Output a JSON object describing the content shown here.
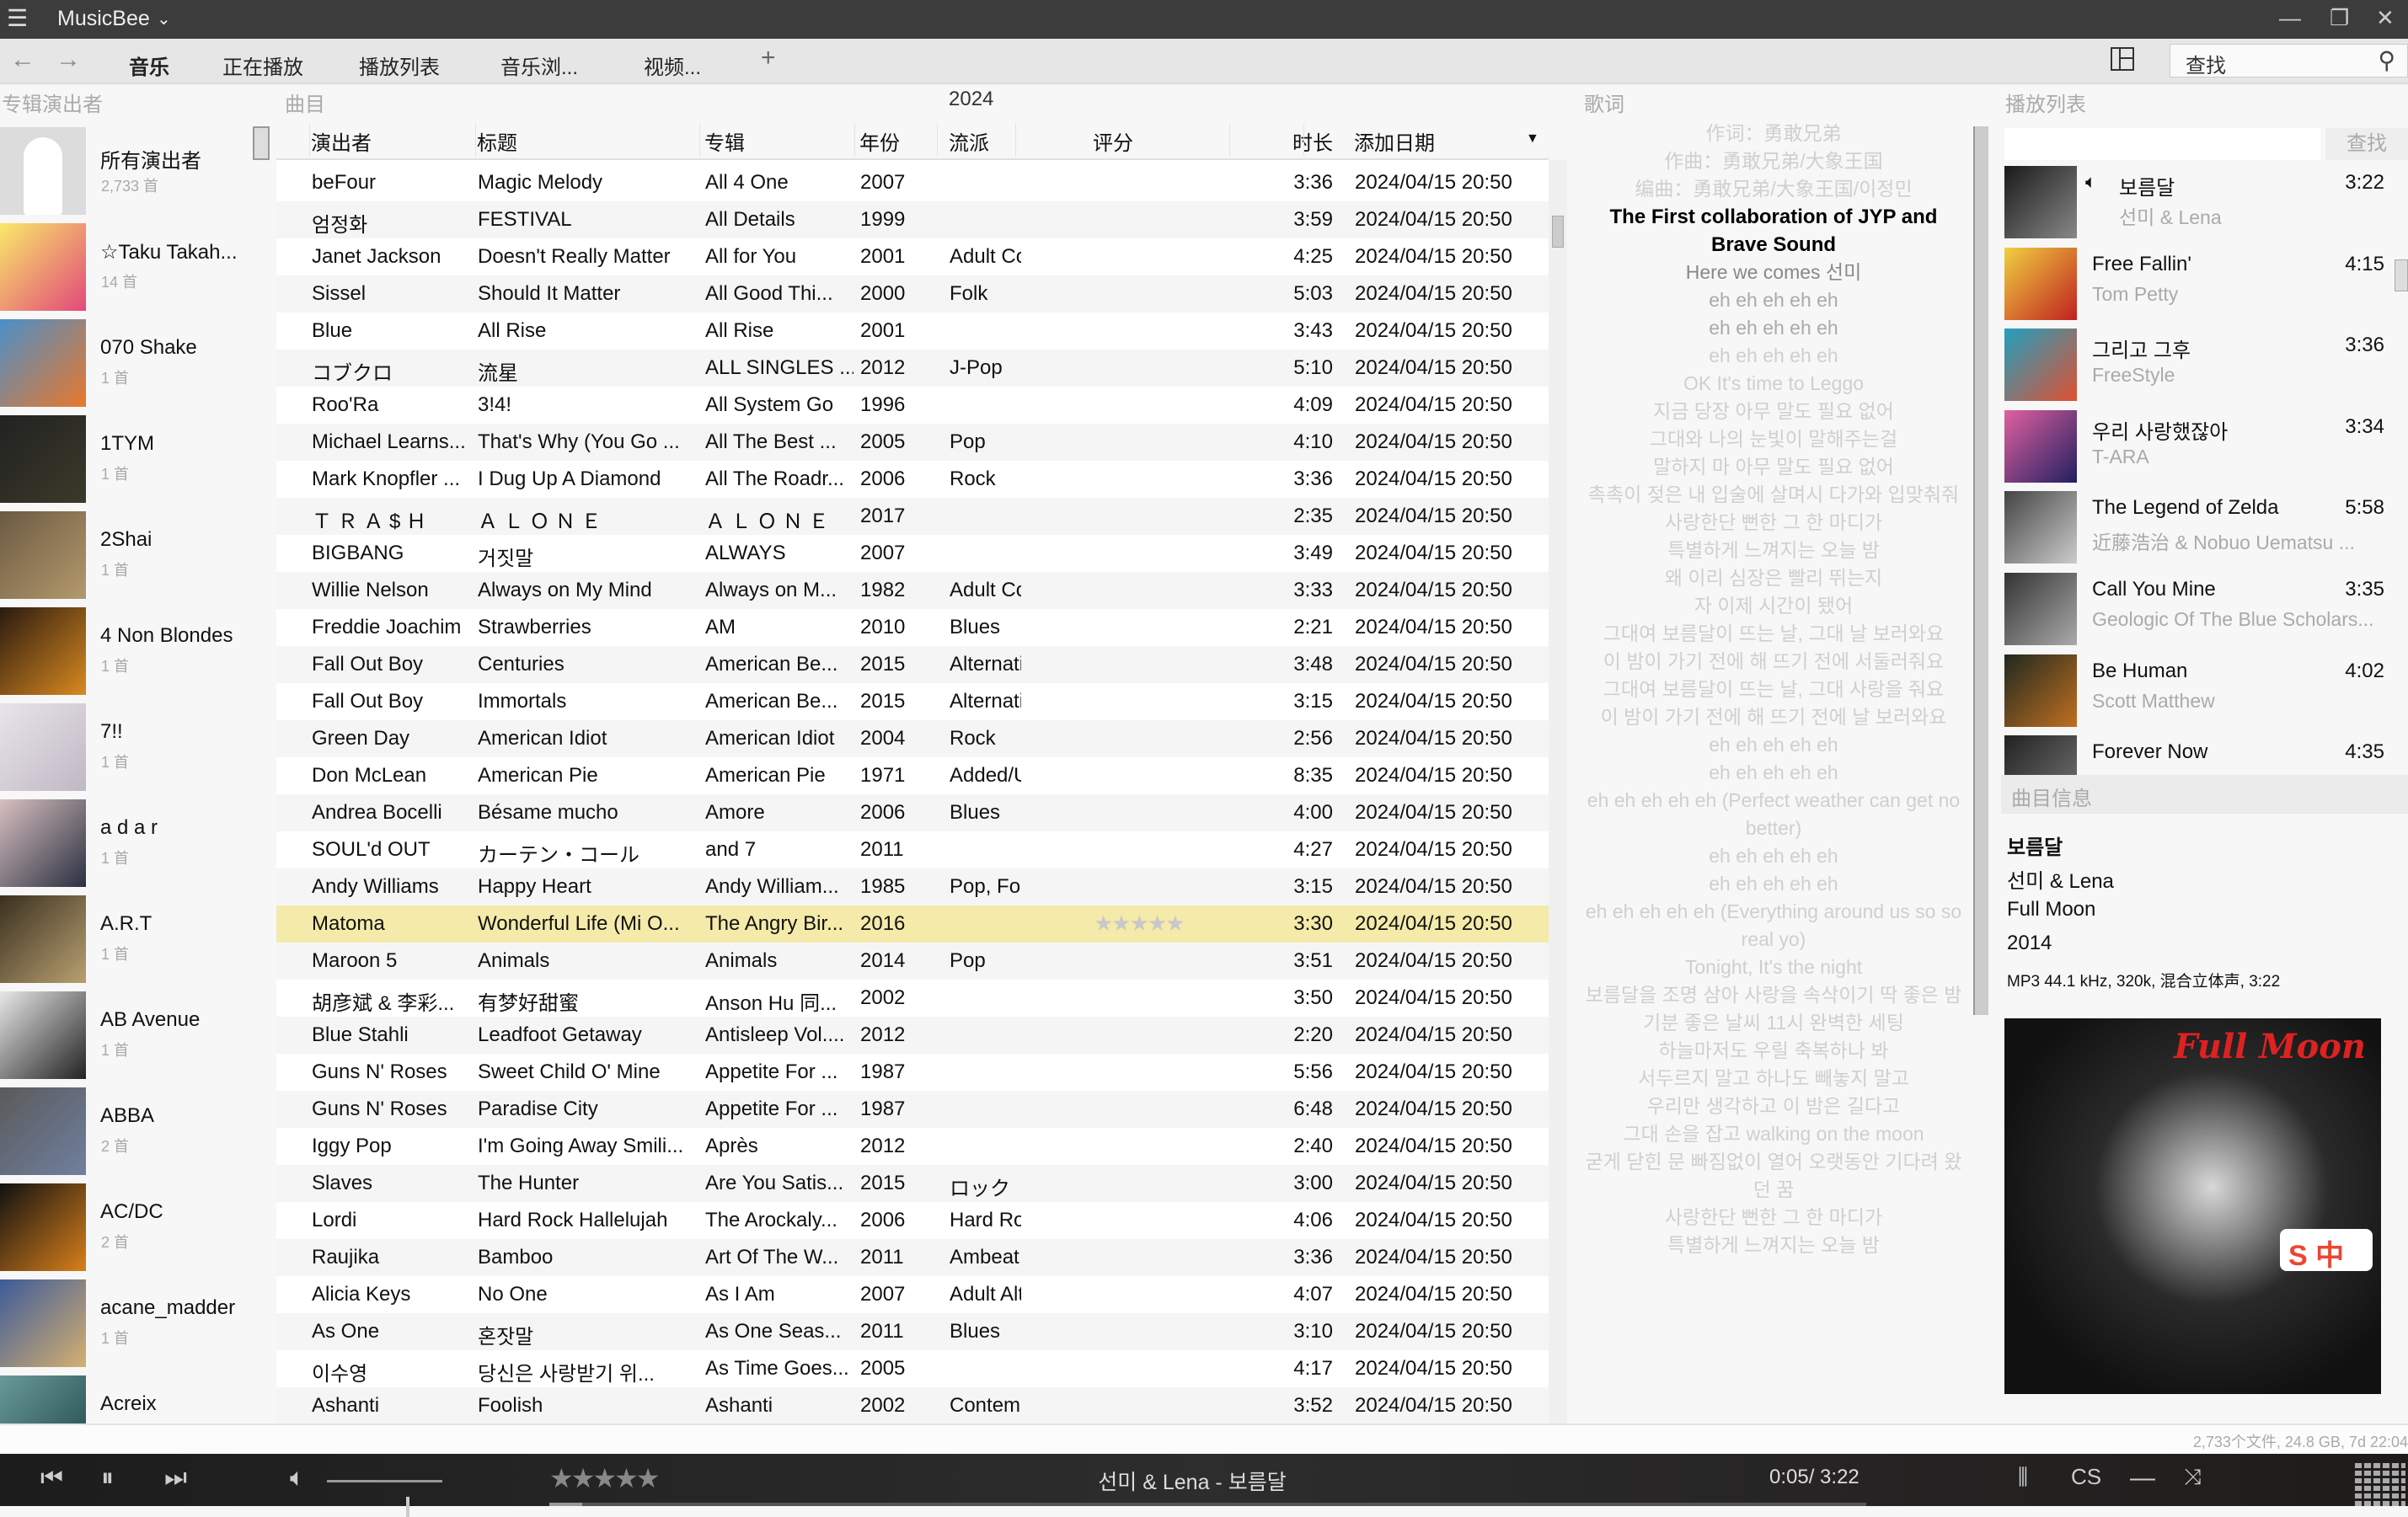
{
  "titlebar": {
    "app_name": "MusicBee"
  },
  "nav": {
    "tabs": [
      "音乐",
      "正在播放",
      "播放列表",
      "音乐浏...",
      "视频..."
    ],
    "active_tab": 0,
    "search_placeholder": "查找"
  },
  "panels": {
    "artists_header": "专辑演出者",
    "tracks_header": "曲目",
    "filter_year": "2024",
    "lyrics_header": "歌词",
    "playlist_header": "播放列表"
  },
  "sidebar": {
    "items": [
      {
        "name": "所有演出者",
        "count": "2,733 首",
        "art": [
          "#dcdcdc",
          "#dcdcdc"
        ]
      },
      {
        "name": "☆Taku Takah...",
        "count": "14 首",
        "art": [
          "#f9e96a",
          "#e2487a"
        ]
      },
      {
        "name": "070 Shake",
        "count": "1 首",
        "art": [
          "#4a90c8",
          "#e8782c"
        ]
      },
      {
        "name": "1TYM",
        "count": "1 首",
        "art": [
          "#222",
          "#3a3a2a"
        ]
      },
      {
        "name": "2Shai",
        "count": "1 首",
        "art": [
          "#6b5a42",
          "#b4996c"
        ]
      },
      {
        "name": "4 Non Blondes",
        "count": "1 首",
        "art": [
          "#2a1a10",
          "#d98a20"
        ]
      },
      {
        "name": "7!!",
        "count": "1 首",
        "art": [
          "#e8e4ea",
          "#c0b8c4"
        ]
      },
      {
        "name": "a d a r",
        "count": "1 首",
        "art": [
          "#d8c0c0",
          "#2a3040"
        ]
      },
      {
        "name": "A.R.T",
        "count": "1 首",
        "art": [
          "#3a3020",
          "#b8a070"
        ]
      },
      {
        "name": "AB Avenue",
        "count": "1 首",
        "art": [
          "#e8e8e8",
          "#222"
        ]
      },
      {
        "name": "ABBA",
        "count": "2 首",
        "art": [
          "#5a5a5a",
          "#7080a0"
        ]
      },
      {
        "name": "AC/DC",
        "count": "2 首",
        "art": [
          "#111",
          "#d8801a"
        ]
      },
      {
        "name": "acane_madder",
        "count": "1 首",
        "art": [
          "#3c5a9a",
          "#d4b070"
        ]
      },
      {
        "name": "Acreix",
        "count": "",
        "art": [
          "#6a9a9a",
          "#204848"
        ]
      }
    ]
  },
  "table": {
    "columns": [
      "演出者",
      "标题",
      "专辑",
      "年份",
      "流派",
      "评分",
      "时长",
      "添加日期"
    ],
    "sort_column": "添加日期",
    "sort_direction": "descending",
    "selected_row": 20,
    "rows": [
      [
        "beFour",
        "Magic Melody",
        "All 4 One",
        "2007",
        "",
        "",
        "3:36",
        "2024/04/15 20:50"
      ],
      [
        "엄정화",
        "FESTIVAL",
        "All Details",
        "1999",
        "",
        "",
        "3:59",
        "2024/04/15 20:50"
      ],
      [
        "Janet Jackson",
        "Doesn't Really Matter",
        "All for You",
        "2001",
        "Adult Conte...",
        "",
        "4:25",
        "2024/04/15 20:50"
      ],
      [
        "Sissel",
        "Should It Matter",
        "All Good Thi...",
        "2000",
        "Folk",
        "",
        "5:03",
        "2024/04/15 20:50"
      ],
      [
        "Blue",
        "All Rise",
        "All Rise",
        "2001",
        "",
        "",
        "3:43",
        "2024/04/15 20:50"
      ],
      [
        "コブクロ",
        "流星",
        "ALL SINGLES ...",
        "2012",
        "J-Pop",
        "",
        "5:10",
        "2024/04/15 20:50"
      ],
      [
        "Roo'Ra",
        "3!4!",
        "All System Go",
        "1996",
        "",
        "",
        "4:09",
        "2024/04/15 20:50"
      ],
      [
        "Michael Learns...",
        "That's Why (You Go ...",
        "All The Best ...",
        "2005",
        "Pop",
        "",
        "4:10",
        "2024/04/15 20:50"
      ],
      [
        "Mark Knopfler ...",
        "I Dug Up A Diamond",
        "All The Roadr...",
        "2006",
        "Rock",
        "",
        "3:36",
        "2024/04/15 20:50"
      ],
      [
        "Ｔ Ｒ Ａ $ Ｈ",
        "Ａ Ｌ Ｏ Ｎ Ｅ",
        "Ａ Ｌ Ｏ Ｎ Ｅ",
        "2017",
        "",
        "",
        "2:35",
        "2024/04/15 20:50"
      ],
      [
        "BIGBANG",
        "거짓말",
        "ALWAYS",
        "2007",
        "",
        "",
        "3:49",
        "2024/04/15 20:50"
      ],
      [
        "Willie Nelson",
        "Always on My Mind",
        "Always on M...",
        "1982",
        "Adult Conte...",
        "",
        "3:33",
        "2024/04/15 20:50"
      ],
      [
        "Freddie Joachim",
        "Strawberries",
        "AM",
        "2010",
        "Blues",
        "",
        "2:21",
        "2024/04/15 20:50"
      ],
      [
        "Fall Out Boy",
        "Centuries",
        "American Be...",
        "2015",
        "Alternative ...",
        "",
        "3:48",
        "2024/04/15 20:50"
      ],
      [
        "Fall Out Boy",
        "Immortals",
        "American Be...",
        "2015",
        "Alternative ...",
        "",
        "3:15",
        "2024/04/15 20:50"
      ],
      [
        "Green Day",
        "American Idiot",
        "American Idiot",
        "2004",
        "Rock",
        "",
        "2:56",
        "2024/04/15 20:50"
      ],
      [
        "Don McLean",
        "American Pie",
        "American Pie",
        "1971",
        "Added/Unk...",
        "",
        "8:35",
        "2024/04/15 20:50"
      ],
      [
        "Andrea Bocelli",
        "Bésame mucho",
        "Amore",
        "2006",
        "Blues",
        "",
        "4:00",
        "2024/04/15 20:50"
      ],
      [
        "SOUL'd OUT",
        "カーテン・コール",
        "and 7",
        "2011",
        "",
        "",
        "4:27",
        "2024/04/15 20:50"
      ],
      [
        "Andy Williams",
        "Happy Heart",
        "Andy William...",
        "1985",
        "Pop, Folk, ...",
        "",
        "3:15",
        "2024/04/15 20:50"
      ],
      [
        "Matoma",
        "Wonderful Life (Mi O...",
        "The Angry Bir...",
        "2016",
        "",
        "★★★★★",
        "3:30",
        "2024/04/15 20:50"
      ],
      [
        "Maroon 5",
        "Animals",
        "Animals",
        "2014",
        "Pop",
        "",
        "3:51",
        "2024/04/15 20:50"
      ],
      [
        "胡彦斌 & 李彩...",
        "有梦好甜蜜",
        "Anson Hu 同...",
        "2002",
        "",
        "",
        "3:50",
        "2024/04/15 20:50"
      ],
      [
        "Blue Stahli",
        "Leadfoot Getaway",
        "Antisleep Vol....",
        "2012",
        "",
        "",
        "2:20",
        "2024/04/15 20:50"
      ],
      [
        "Guns N' Roses",
        "Sweet Child O' Mine",
        "Appetite For ...",
        "1987",
        "",
        "",
        "5:56",
        "2024/04/15 20:50"
      ],
      [
        "Guns N' Roses",
        "Paradise City",
        "Appetite For ...",
        "1987",
        "",
        "",
        "6:48",
        "2024/04/15 20:50"
      ],
      [
        "Iggy Pop",
        "I'm Going Away Smili...",
        "Après",
        "2012",
        "",
        "",
        "2:40",
        "2024/04/15 20:50"
      ],
      [
        "Slaves",
        "The Hunter",
        "Are You Satis...",
        "2015",
        "ロック",
        "",
        "3:00",
        "2024/04/15 20:50"
      ],
      [
        "Lordi",
        "Hard Rock Hallelujah",
        "The Arockaly...",
        "2006",
        "Hard Rock",
        "",
        "4:06",
        "2024/04/15 20:50"
      ],
      [
        "Raujika",
        "Bamboo",
        "Art Of The W...",
        "2011",
        "Ambeat",
        "",
        "3:36",
        "2024/04/15 20:50"
      ],
      [
        "Alicia Keys",
        "No One",
        "As I Am",
        "2007",
        "Adult Altern...",
        "",
        "4:07",
        "2024/04/15 20:50"
      ],
      [
        "As One",
        "혼잣말",
        "As One Seas...",
        "2011",
        "Blues",
        "",
        "3:10",
        "2024/04/15 20:50"
      ],
      [
        "이수영",
        "당신은 사랑받기 위...",
        "As Time Goes...",
        "2005",
        "",
        "",
        "4:17",
        "2024/04/15 20:50"
      ],
      [
        "Ashanti",
        "Foolish",
        "Ashanti",
        "2002",
        "Contempor...",
        "",
        "3:52",
        "2024/04/15 20:50"
      ]
    ]
  },
  "lyrics": {
    "current_line": 3,
    "lines": [
      "作词：勇敢兄弟",
      "作曲：勇敢兄弟/大象王国",
      "编曲：勇敢兄弟/大象王国/이정민",
      "The First collaboration of JYP and Brave Sound",
      "Here we comes 선미",
      "eh eh eh eh eh",
      "eh eh eh eh eh",
      "eh eh eh eh eh",
      "OK It's time to Leggo",
      "지금 당장 아무 말도 필요 없어",
      "그대와 나의 눈빛이 말해주는걸",
      "말하지 마 아무 말도 필요 없어",
      "촉촉이 젖은 내 입술에 살며시 다가와 입맞춰줘",
      "사랑한단 뻔한 그 한 마디가",
      "특별하게 느껴지는 오늘 밤",
      "왜 이리 심장은 빨리 뛰는지",
      "자 이제 시간이 됐어",
      "그대여 보름달이 뜨는 날, 그대 날 보러와요",
      "이 밤이 가기 전에 해 뜨기 전에 서둘러줘요",
      "그대여 보름달이 뜨는 날, 그대 사랑을 줘요",
      "이 밤이 가기 전에 해 뜨기 전에 날 보러와요",
      "eh eh eh eh eh",
      "eh eh eh eh eh",
      "eh eh eh eh eh (Perfect weather can get no better)",
      "eh eh eh eh eh",
      "eh eh eh eh eh",
      "eh eh eh eh eh (Everything around us so so real yo)",
      "Tonight, It's the night",
      "보름달을 조명 삼아 사랑을 속삭이기 딱 좋은 밤",
      "기분 좋은 날씨 11시 완벽한 세팅",
      "하늘마저도 우릴 축복하나 봐",
      "서두르지 말고 하나도 빼놓지 말고",
      "우리만 생각하고 이 밤은 길다고",
      "그대 손을 잡고 walking on the moon",
      "굳게 닫힌 문 빠짐없이 열어 오랫동안 기다려 왔던 꿈",
      "사랑한단 뻔한 그 한 마디가",
      "특별하게 느껴지는 오늘 밤"
    ]
  },
  "playlist": {
    "search_button": "查找",
    "playing_index": 0,
    "items": [
      {
        "title": "보름달",
        "artist": "선미 & Lena",
        "duration": "3:22",
        "art": [
          "#1a1a1a",
          "#888"
        ]
      },
      {
        "title": "Free Fallin'",
        "artist": "Tom Petty",
        "duration": "4:15",
        "art": [
          "#f0d040",
          "#c02020"
        ]
      },
      {
        "title": "그리고 그후",
        "artist": "FreeStyle",
        "duration": "3:36",
        "art": [
          "#20a0c0",
          "#e05030"
        ]
      },
      {
        "title": "우리 사랑했잖아",
        "artist": "T-ARA",
        "duration": "3:34",
        "art": [
          "#e060a0",
          "#202060"
        ]
      },
      {
        "title": "The Legend of Zelda",
        "artist": "近藤浩治 & Nobuo Uematsu ...",
        "duration": "5:58",
        "art": [
          "#444",
          "#ccc"
        ]
      },
      {
        "title": "Call You Mine",
        "artist": "Geologic Of The Blue Scholars...",
        "duration": "3:35",
        "art": [
          "#333",
          "#aaa"
        ]
      },
      {
        "title": "Be Human",
        "artist": "Scott Matthew",
        "duration": "4:02",
        "art": [
          "#202820",
          "#c07020"
        ]
      },
      {
        "title": "Forever Now",
        "artist": "",
        "duration": "4:35",
        "art": [
          "#222",
          "#777"
        ]
      }
    ]
  },
  "track_info": {
    "header": "曲目信息",
    "title": "보름달",
    "artist": "선미 & Lena",
    "album": "Full Moon",
    "year": "2014",
    "format": "MP3 44.1 kHz, 320k, 混合立体声, 3:22",
    "cover_text": "Full Moon",
    "ime_badge": "S 中"
  },
  "status": {
    "summary": "2,733个文件, 24.8 GB, 7d 22:04"
  },
  "player": {
    "now_playing": "선미 & Lena - 보름달",
    "time": "0:05/ 3:22",
    "volume": 0.7,
    "progress": 0.025,
    "rating_stars": "★★★★★"
  }
}
